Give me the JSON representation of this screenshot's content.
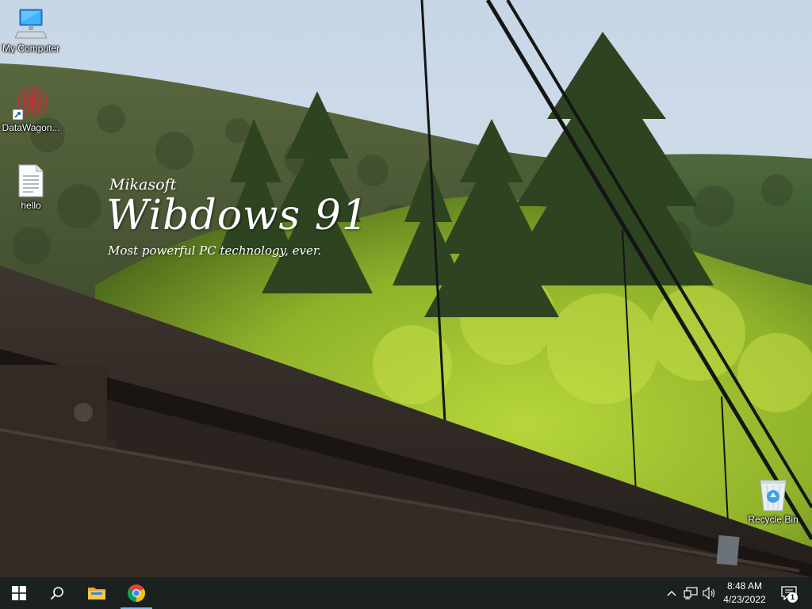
{
  "desktop": {
    "icons": [
      {
        "label": "My Computer",
        "icon": "computer-icon"
      },
      {
        "label": "DataWagon...",
        "icon": "datawagon-icon"
      },
      {
        "label": "hello",
        "icon": "text-file-icon"
      },
      {
        "label": "Recycle Bin",
        "icon": "recycle-bin-icon"
      }
    ],
    "branding": {
      "company": "Mikasoft",
      "title": "Wibdows 91",
      "tagline": "Most powerful PC technology, ever."
    }
  },
  "taskbar": {
    "apps": [
      {
        "name": "Start",
        "icon": "windows-logo-icon"
      },
      {
        "name": "Search",
        "icon": "search-icon"
      },
      {
        "name": "File Explorer",
        "icon": "folder-icon"
      },
      {
        "name": "Google Chrome",
        "icon": "chrome-icon",
        "active": true
      }
    ],
    "tray": {
      "time": "8:48 AM",
      "date": "4/23/2022",
      "notification_count": "1"
    }
  },
  "colors": {
    "taskbar": "#121612",
    "active_indicator": "#76b9ed",
    "label_text": "#ffffff"
  }
}
